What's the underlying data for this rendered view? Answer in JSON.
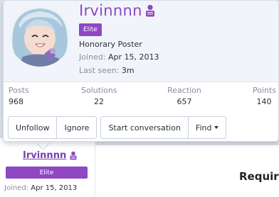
{
  "profile": {
    "username": "Irvinnnn",
    "badge": "Elite",
    "title": "Honorary Poster",
    "joined_label": "Joined:",
    "joined_value": "Apr 15, 2013",
    "last_seen_label": "Last seen:",
    "last_seen_value": "3m"
  },
  "stats": {
    "posts_label": "Posts",
    "posts_value": "968",
    "solutions_label": "Solutions",
    "solutions_value": "22",
    "reaction_label": "Reaction",
    "reaction_value": "657",
    "points_label": "Points",
    "points_value": "140"
  },
  "actions": {
    "unfollow": "Unfollow",
    "ignore": "Ignore",
    "start_conversation": "Start conversation",
    "find": "Find"
  },
  "background": {
    "username": "Irvinnnn",
    "badge": "Elite",
    "joined_label": "Joined:",
    "joined_value": "Apr 15, 2013",
    "heading": "Require"
  },
  "colors": {
    "accent": "#8f47c4",
    "text": "#2c2f36",
    "muted": "#8a8f99"
  }
}
